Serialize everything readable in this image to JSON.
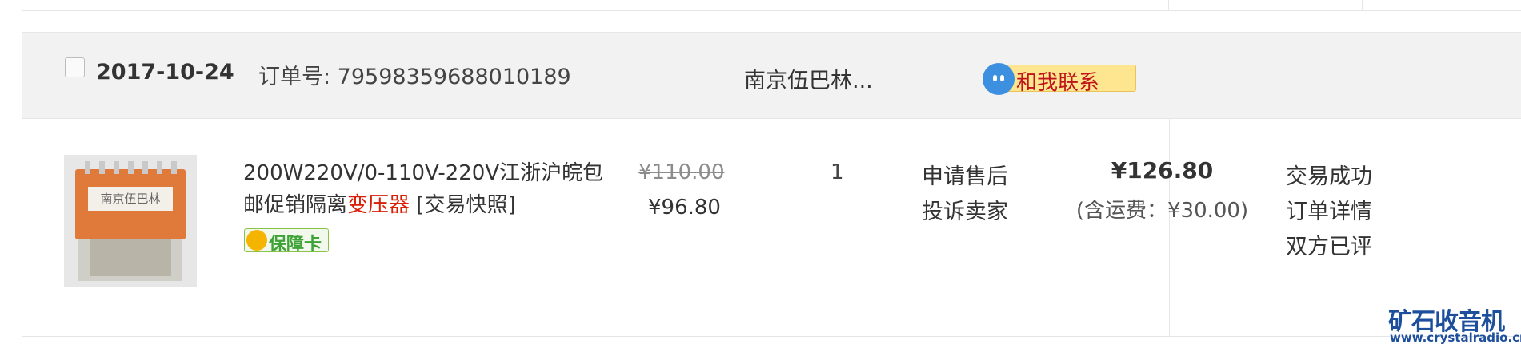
{
  "order": {
    "date": "2017-10-24",
    "order_number_label": "订单号: 79598359688010189",
    "seller": "南京伍巴林...",
    "contact_label": "和我联系",
    "colors": {
      "header_bg": "#f2f2f2",
      "keyword_red": "#d81e06",
      "contact_pill": "#fde68f",
      "badge_green": "#3ea336"
    },
    "item": {
      "thumbnail_icon": "transformer-product-photo",
      "thumbnail_label": "南京伍巴林",
      "title_main": "200W220V/0-110V-220V江浙沪皖包邮促销隔离",
      "title_keyword": "变压器",
      "snapshot_link": "[交易快照]",
      "guarantee_badge": "保障卡",
      "original_price": "¥110.00",
      "price": "¥96.80",
      "quantity": "1",
      "after_sale_link": "申请售后",
      "complain_link": "投诉卖家"
    },
    "total": "¥126.80",
    "shipping_note": "(含运费：¥30.00)",
    "status": "交易成功",
    "detail_link": "订单详情",
    "rating_status": "双方已评"
  },
  "watermark": {
    "title": "矿石收音机",
    "url": "www.crystalradio.cn"
  }
}
